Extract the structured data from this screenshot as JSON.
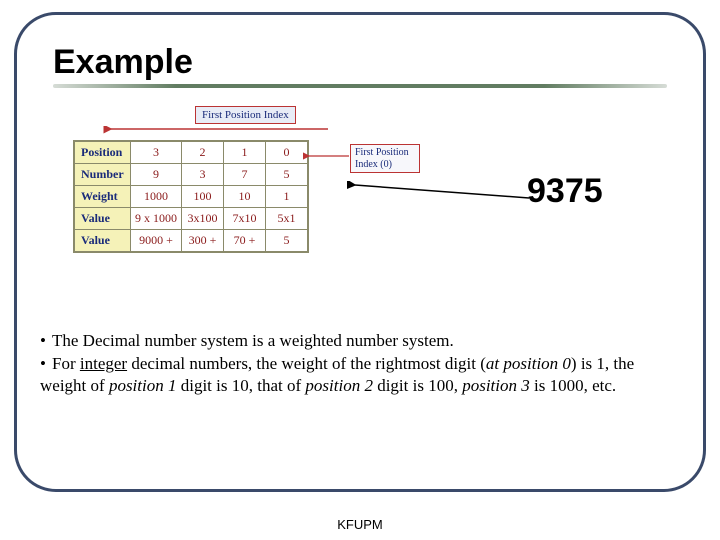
{
  "title": "Example",
  "fpi_label": "First Position Index",
  "fpi0_label": "First Position\nIndex (0)",
  "big_number": "9375",
  "table": {
    "rows": [
      {
        "header": "Position",
        "cells": [
          "3",
          "2",
          "1",
          "0"
        ]
      },
      {
        "header": "Number",
        "cells": [
          "9",
          "3",
          "7",
          "5"
        ]
      },
      {
        "header": "Weight",
        "cells": [
          "1000",
          "100",
          "10",
          "1"
        ]
      },
      {
        "header": "Value",
        "cells": [
          "9 x 1000",
          "3x100",
          "7x10",
          "5x1"
        ]
      },
      {
        "header": "Value",
        "cells": [
          "9000  +",
          "300  +",
          "70 +",
          "5"
        ]
      }
    ]
  },
  "bullets": {
    "b0_pre": "The Decimal number system is a weighted number system.",
    "b1_a": "For ",
    "b1_u": "integer",
    "b1_b": " decimal numbers, the weight of the rightmost digit (",
    "b1_i0": "at position 0",
    "b1_c": ") is 1, the weight of ",
    "b1_i1": "position 1",
    "b1_d": " digit is 10, that of ",
    "b1_i2": "position 2",
    "b1_e": " digit is 100, ",
    "b1_i3": "position 3",
    "b1_f": " is 1000, etc."
  },
  "footer": "KFUPM",
  "chart_data": {
    "type": "table",
    "title": "Decimal positional breakdown of 9375",
    "columns": [
      "Position 3",
      "Position 2",
      "Position 1",
      "Position 0"
    ],
    "rows": [
      {
        "label": "Position",
        "values": [
          3,
          2,
          1,
          0
        ]
      },
      {
        "label": "Number",
        "values": [
          9,
          3,
          7,
          5
        ]
      },
      {
        "label": "Weight",
        "values": [
          1000,
          100,
          10,
          1
        ]
      },
      {
        "label": "Value (product)",
        "values": [
          "9×1000",
          "3×100",
          "7×10",
          "5×1"
        ]
      },
      {
        "label": "Value (sum terms)",
        "values": [
          9000,
          300,
          70,
          5
        ]
      }
    ],
    "annotations": [
      "First Position Index",
      "First Position Index (0)",
      "9375"
    ]
  }
}
